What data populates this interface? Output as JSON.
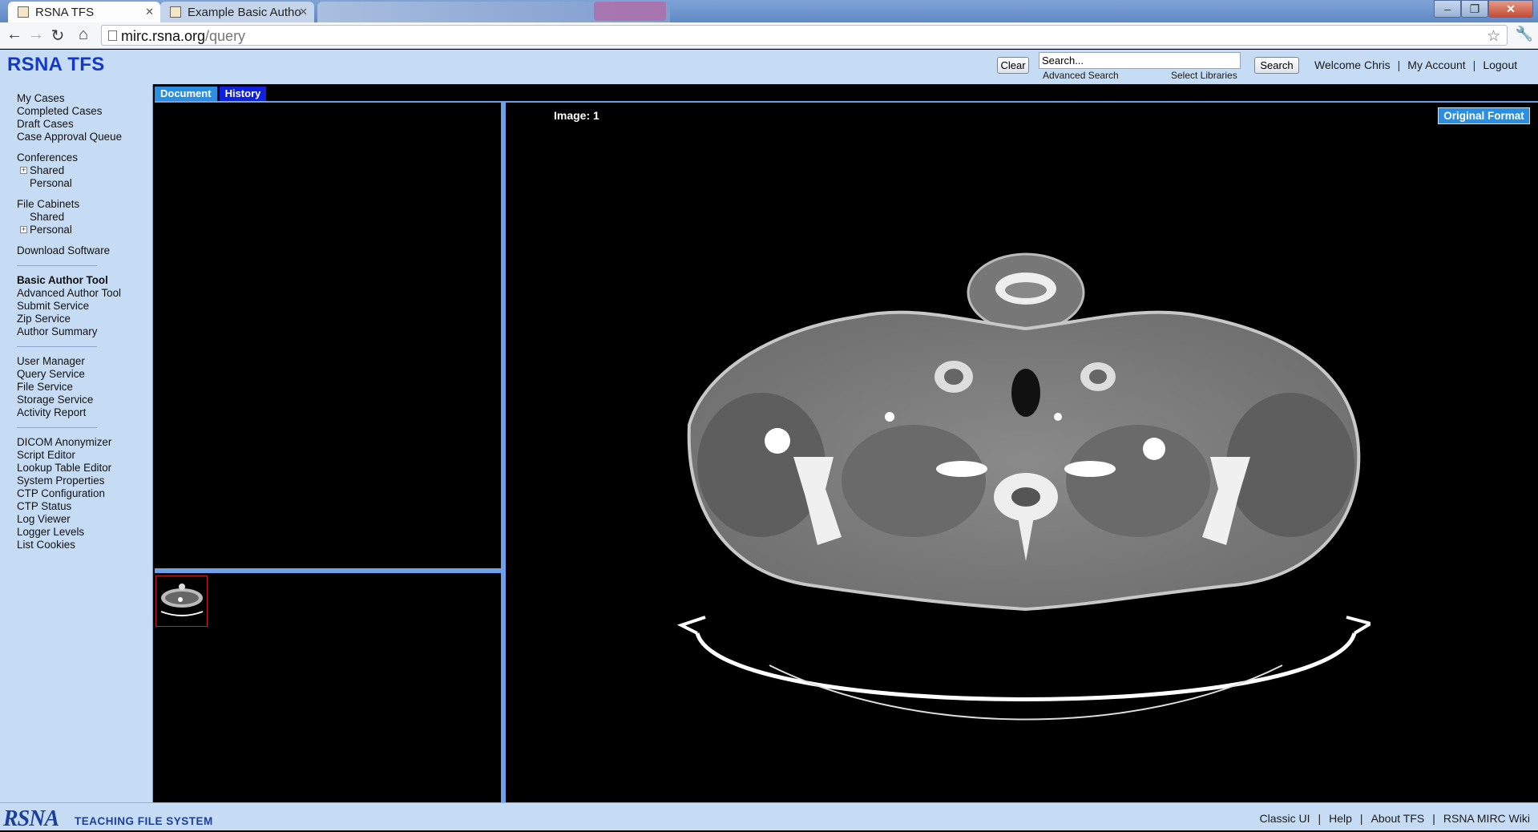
{
  "browser": {
    "tabs": [
      {
        "title": "RSNA TFS",
        "active": true
      },
      {
        "title": "Example Basic Autho",
        "active": false
      },
      {
        "title": "",
        "active": false
      }
    ],
    "url_host": "mirc.rsna.org",
    "url_path": "/query"
  },
  "header": {
    "logo": "RSNA TFS",
    "clear_label": "Clear",
    "search_value": "Search...",
    "search_label": "Search",
    "advanced_search": "Advanced Search",
    "select_libraries": "Select Libraries",
    "welcome": "Welcome Chris",
    "my_account": "My Account",
    "logout": "Logout"
  },
  "sidebar": {
    "cases": [
      "My Cases",
      "Completed Cases",
      "Draft Cases",
      "Case Approval Queue"
    ],
    "conferences": {
      "title": "Conferences",
      "shared": "Shared",
      "personal": "Personal"
    },
    "file_cabinets": {
      "title": "File Cabinets",
      "shared": "Shared",
      "personal": "Personal"
    },
    "download": "Download Software",
    "author": [
      "Basic Author Tool",
      "Advanced Author Tool",
      "Submit Service",
      "Zip Service",
      "Author Summary"
    ],
    "admin": [
      "User Manager",
      "Query Service",
      "File Service",
      "Storage Service",
      "Activity Report"
    ],
    "tools": [
      "DICOM Anonymizer",
      "Script Editor",
      "Lookup Table Editor",
      "System Properties",
      "CTP Configuration",
      "CTP Status",
      "Log Viewer",
      "Logger Levels",
      "List Cookies"
    ]
  },
  "content": {
    "tabs": [
      "Document",
      "History"
    ],
    "image_label": "Image: 1",
    "original_format": "Original Format"
  },
  "footer": {
    "logo": "RSNA",
    "tagline": "TEACHING FILE SYSTEM",
    "links": [
      "Classic UI",
      "Help",
      "About TFS",
      "RSNA MIRC Wiki"
    ]
  },
  "colors": {
    "panel_bg": "#c6dcf4",
    "accent": "#2a8fe0",
    "logo_blue": "#1438c8",
    "splitter": "#6fa0e8"
  }
}
